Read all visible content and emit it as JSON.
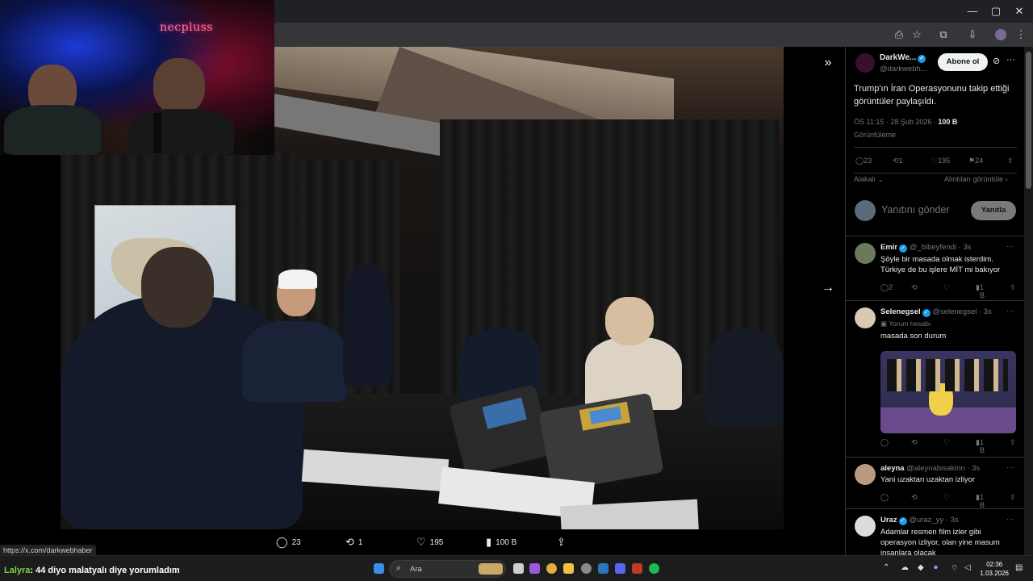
{
  "browser": {
    "window_controls": [
      "—",
      "▢",
      "✕"
    ]
  },
  "webcam": {
    "logo_text": "necpluss"
  },
  "viewer": {
    "actions": {
      "replies": "23",
      "reposts": "1",
      "likes": "195",
      "views": "100 B"
    },
    "status_url": "https://x.com/darkwebhaber"
  },
  "tweet": {
    "author_name": "DarkWe...",
    "author_handle": "@darkwebh...",
    "follow_label": "Abone ol",
    "text": "Trump'ın İran Operasyonunu takip ettiği görüntüler paylaşıldı.",
    "timestamp": "ÖS 11:15 · 28 Şub 2026 · ",
    "views_count": "100 B",
    "views_label": "Görüntüleme",
    "stats": {
      "replies": "23",
      "reposts": "1",
      "likes": "195",
      "bookmarks": "24"
    },
    "sort_label": "Alakalı",
    "quotes_link": "Alıntıları görüntüle",
    "reply_placeholder": "Yanıtını gönder",
    "reply_button": "Yanıtla"
  },
  "replies": [
    {
      "name": "Emir",
      "handle": "@_bibeyfendi · 3s",
      "text": "Şöyle bir masada olmak isterdim. Türkiye de bu işlere MİT mi bakıyor",
      "replies": "2",
      "views": "1 B"
    },
    {
      "name": "Selenegsel",
      "handle": "@selenegsel · 3s",
      "tag": "Yorum hesabı",
      "text": "masada son durum",
      "views": "1 B"
    },
    {
      "name": "aleyna",
      "handle": "@aleynabisakinn · 3s",
      "text": "Yani uzaktan uzaktan izliyor",
      "views": "1 B"
    },
    {
      "name": "Uraz",
      "handle": "@uraz_yy · 3s",
      "text": "Adamlar resmen film izler gibi operasyon izliyor, olan yine masum insanlara olacak"
    }
  ],
  "taskbar": {
    "chat_user": "Lalyra",
    "chat_message": ": 44 diyo malatyalı diye yorumladım",
    "search_placeholder": "Ara",
    "time": "02:36",
    "date": "1.03.2026"
  },
  "colors": {
    "accent": "#1d9bf0",
    "chat_user": "#7bd13b",
    "panel_bg": "#000000"
  }
}
